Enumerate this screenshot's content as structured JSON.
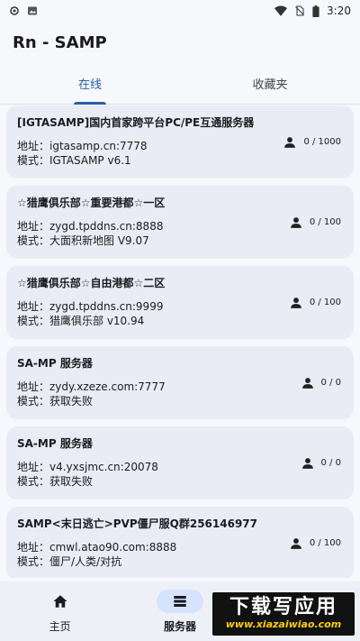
{
  "statusbar": {
    "time": "3:20"
  },
  "app": {
    "title": "Rn - SAMP"
  },
  "tabs": [
    {
      "label": "在线"
    },
    {
      "label": "收藏夹"
    }
  ],
  "servers": [
    {
      "name": "[IGTASAMP]国内首家跨平台PC/PE互通服务器",
      "address": "地址：igtasamp.cn:7778",
      "mode": "模式：IGTASAMP v6.1",
      "players": "0 / 1000"
    },
    {
      "name": "☆猎鹰俱乐部☆重要港都☆一区",
      "address": "地址：zygd.tpddns.cn:8888",
      "mode": "模式：大面积新地图 V9.07",
      "players": "0 / 100"
    },
    {
      "name": "☆猎鹰俱乐部☆自由港都☆二区",
      "address": "地址：zygd.tpddns.cn:9999",
      "mode": "模式：猎鹰俱乐部  v10.94",
      "players": "0 / 100"
    },
    {
      "name": "SA-MP 服务器",
      "address": "地址：zydy.xzeze.com:7777",
      "mode": "模式：获取失败",
      "players": "0 / 0"
    },
    {
      "name": "SA-MP 服务器",
      "address": "地址：v4.yxsjmc.cn:20078",
      "mode": "模式：获取失败",
      "players": "0 / 0"
    },
    {
      "name": "SAMP<末日逃亡>PVP僵尸服Q群256146977",
      "address": "地址：cmwl.atao90.com:8888",
      "mode": "模式：僵尸/人类/对抗",
      "players": "0 / 100"
    }
  ],
  "bottomnav": [
    {
      "label": "主页",
      "icon": "home-icon"
    },
    {
      "label": "服务器",
      "icon": "server-list-icon"
    }
  ],
  "watermark": {
    "main": "下载写应用",
    "sub": "www.xiazaiwiao.com"
  }
}
